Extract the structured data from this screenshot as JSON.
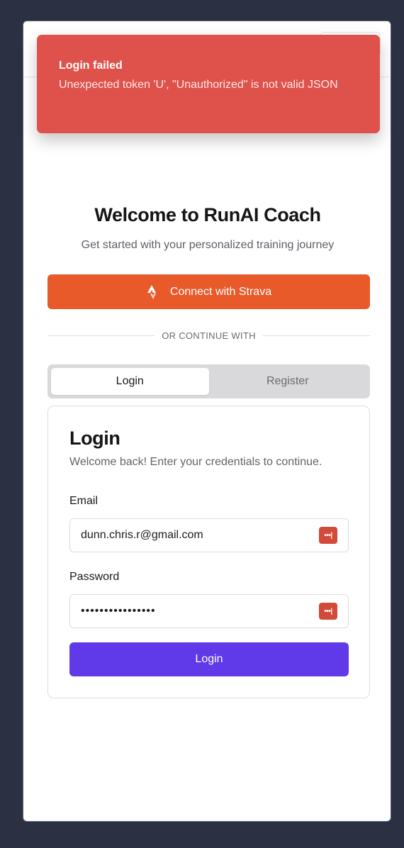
{
  "toast": {
    "title": "Login failed",
    "message": "Unexpected token 'U', \"Unauthorized\" is not valid JSON"
  },
  "welcome": {
    "title": "Welcome to RunAI Coach",
    "subtitle": "Get started with your personalized training journey"
  },
  "strava": {
    "label": "Connect with Strava",
    "icon": "strava-icon"
  },
  "divider": {
    "label": "OR CONTINUE WITH"
  },
  "tabs": [
    {
      "label": "Login",
      "active": true
    },
    {
      "label": "Register",
      "active": false
    }
  ],
  "form": {
    "title": "Login",
    "description": "Welcome back! Enter your credentials to continue.",
    "email_label": "Email",
    "email_value": "dunn.chris.r@gmail.com",
    "password_label": "Password",
    "password_value": "••••••••••••••••",
    "password_manager_icon": "password-manager-icon",
    "submit_label": "Login"
  },
  "colors": {
    "toast_bg": "#df524b",
    "strava": "#e85a2a",
    "primary": "#6039e8",
    "background": "#2b3142"
  }
}
